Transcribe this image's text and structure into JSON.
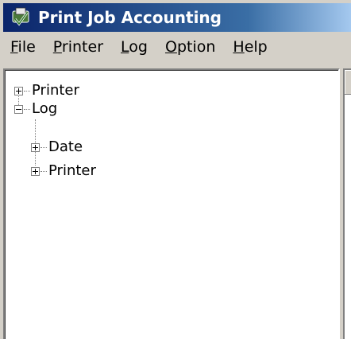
{
  "window": {
    "title": "Print Job Accounting",
    "icon": "printer-accounting-icon"
  },
  "menubar": {
    "items": [
      {
        "label": "File",
        "mnemonic": "F",
        "rest": "ile"
      },
      {
        "label": "Printer",
        "mnemonic": "P",
        "rest": "rinter"
      },
      {
        "label": "Log",
        "mnemonic": "L",
        "rest": "og"
      },
      {
        "label": "Option",
        "mnemonic": "O",
        "rest": "ption"
      },
      {
        "label": "Help",
        "mnemonic": "H",
        "rest": "elp"
      }
    ]
  },
  "tree": {
    "nodes": [
      {
        "label": "Printer",
        "expanded": false,
        "level": 0
      },
      {
        "label": "Log",
        "expanded": true,
        "level": 0,
        "children": [
          {
            "label": "Date",
            "expanded": false,
            "level": 1
          },
          {
            "label": "Printer",
            "expanded": false,
            "level": 1
          }
        ]
      }
    ]
  }
}
